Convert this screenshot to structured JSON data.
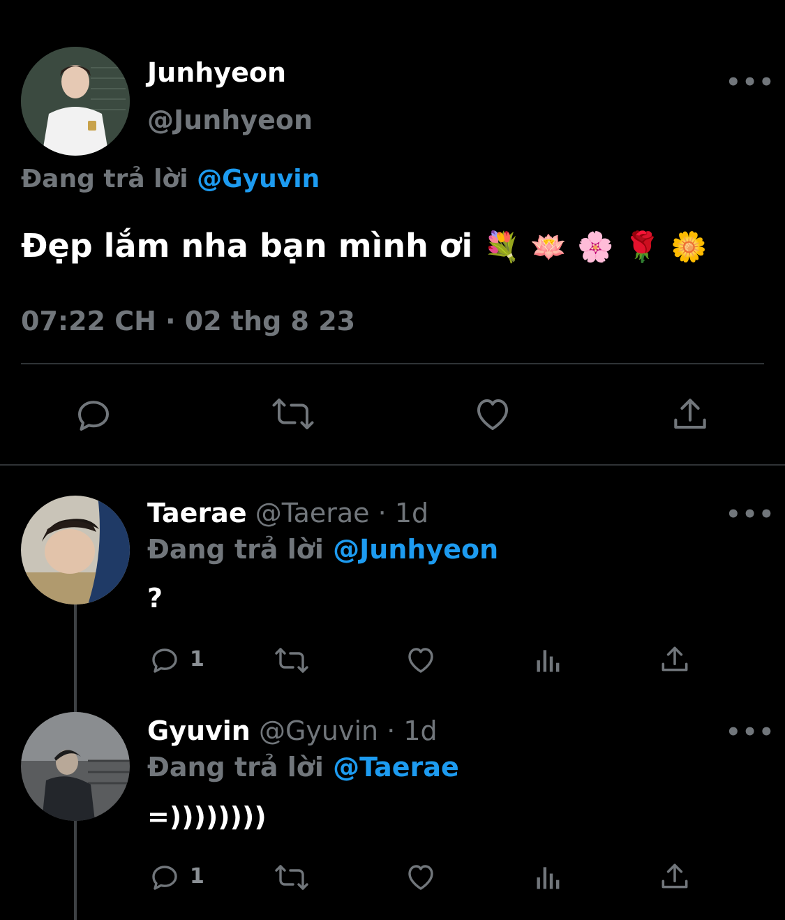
{
  "main_tweet": {
    "display_name": "Junhyeon",
    "handle": "@Junhyeon",
    "reply_prefix": "Đang trả lời",
    "reply_to": "@Gyuvin",
    "text": "Đẹp lắm nha bạn mình ơi",
    "emojis": "💐 🪷 🌸 🌹 🌼",
    "timestamp": "07:22 CH · 02 thg 8 23",
    "more_label": "•••"
  },
  "replies": [
    {
      "display_name": "Taerae",
      "handle": "@Taerae",
      "time": "· 1d",
      "reply_prefix": "Đang trả lời",
      "reply_to": "@Junhyeon",
      "text": "?",
      "reply_count": "1",
      "more_label": "•••"
    },
    {
      "display_name": "Gyuvin",
      "handle": "@Gyuvin",
      "time": "· 1d",
      "reply_prefix": "Đang trả lời",
      "reply_to": "@Taerae",
      "text": "=))))))))",
      "reply_count": "1",
      "more_label": "•••"
    }
  ],
  "icons": {
    "reply": "reply-icon",
    "retweet": "retweet-icon",
    "like": "heart-icon",
    "share": "share-icon",
    "analytics": "analytics-icon"
  },
  "colors": {
    "background": "#000000",
    "link": "#1d9bf0",
    "muted": "#71767b"
  }
}
